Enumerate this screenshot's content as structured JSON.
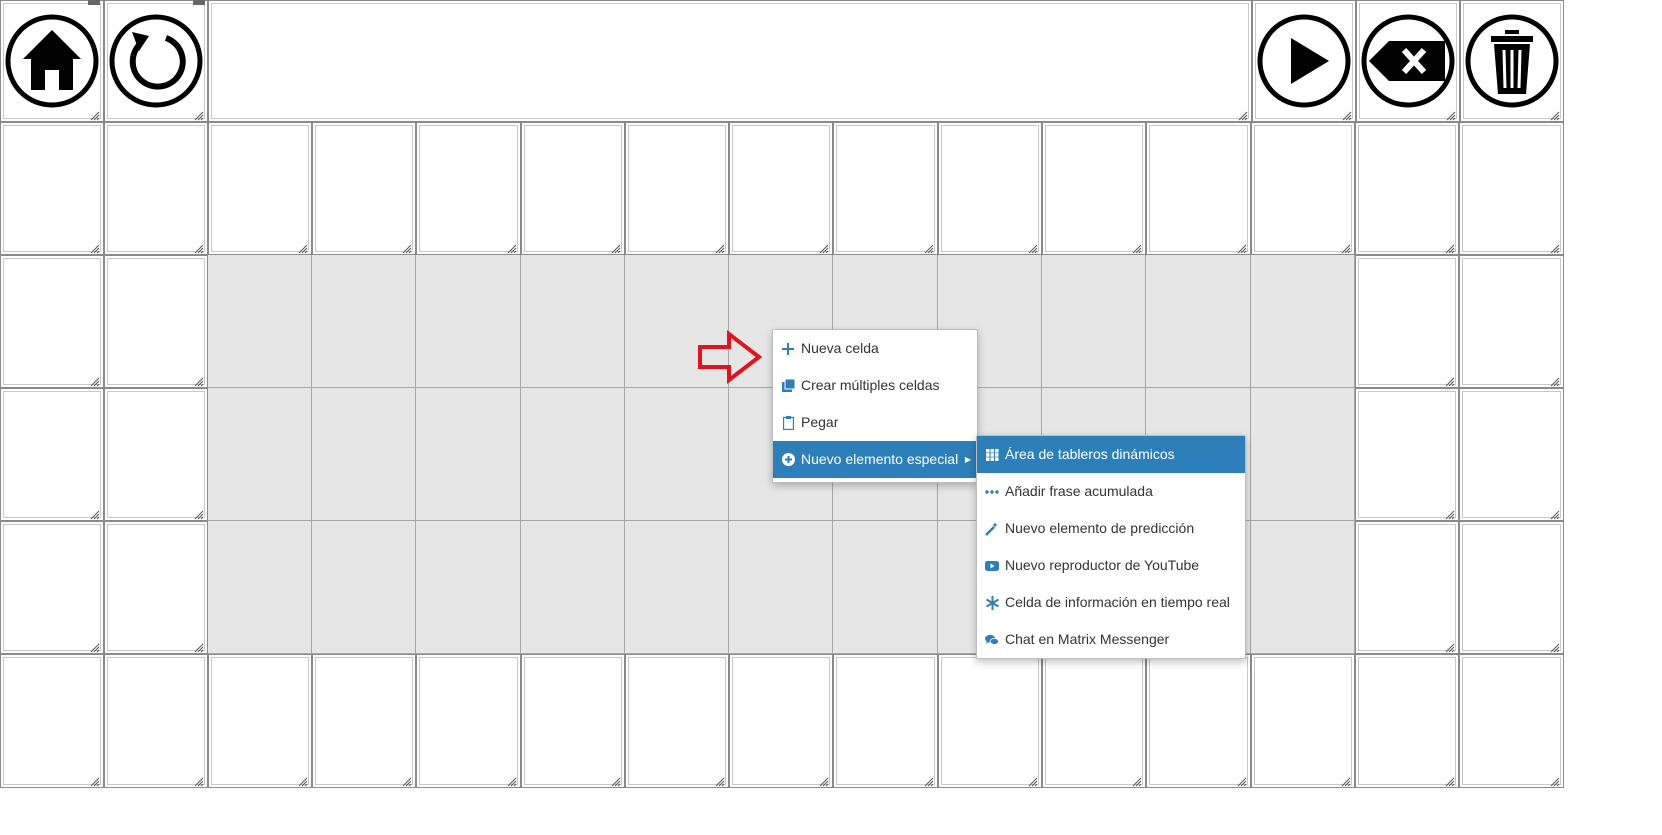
{
  "toolbar": {
    "home_icon": "home-icon",
    "back_icon": "undo-icon",
    "play_icon": "play-icon",
    "backspace_icon": "backspace-icon",
    "delete_icon": "trash-icon"
  },
  "grid": {
    "columns": 15,
    "rows": 6,
    "empty_area_color": "#e6e6e6"
  },
  "context_menu": {
    "items": [
      {
        "label": "Nueva celda",
        "icon": "plus-icon"
      },
      {
        "label": "Crear múltiples celdas",
        "icon": "copy-icon"
      },
      {
        "label": "Pegar",
        "icon": "clipboard-icon"
      },
      {
        "label": "Nuevo elemento especial",
        "icon": "circle-plus-icon",
        "active": true,
        "has_submenu": true
      }
    ]
  },
  "submenu": {
    "items": [
      {
        "label": "Área de tableros dinámicos",
        "icon": "grid-icon",
        "active": true
      },
      {
        "label": "Añadir frase acumulada",
        "icon": "ellipsis-icon"
      },
      {
        "label": "Nuevo elemento de predicción",
        "icon": "magic-wand-icon"
      },
      {
        "label": "Nuevo reproductor de YouTube",
        "icon": "youtube-icon"
      },
      {
        "label": "Celda de información en tiempo real",
        "icon": "asterisk-icon"
      },
      {
        "label": "Chat en Matrix Messenger",
        "icon": "chat-icon"
      }
    ]
  },
  "annotation": {
    "arrow_color": "#e0141e"
  },
  "colors": {
    "accent": "#2c7fb8",
    "cell_border": "#8a8a8a"
  }
}
